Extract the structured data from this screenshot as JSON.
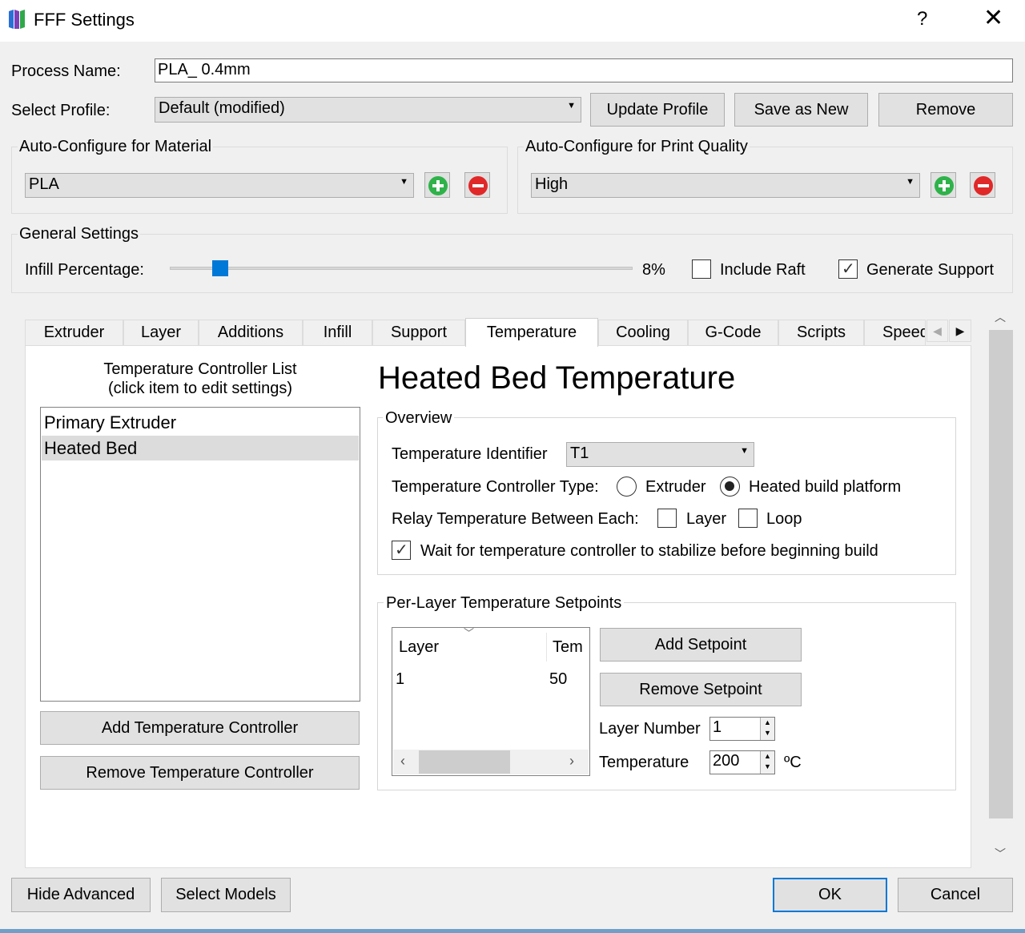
{
  "window": {
    "title": "FFF Settings",
    "help": "?",
    "close": "✕"
  },
  "process": {
    "label": "Process Name:",
    "value": "PLA_ 0.4mm"
  },
  "profile": {
    "label": "Select Profile:",
    "value": "Default (modified)",
    "update": "Update Profile",
    "save_new": "Save as New",
    "remove": "Remove"
  },
  "material": {
    "title": "Auto-Configure for Material",
    "value": "PLA"
  },
  "quality": {
    "title": "Auto-Configure for Print Quality",
    "value": "High"
  },
  "general": {
    "title": "General Settings",
    "infill_label": "Infill Percentage:",
    "infill_value": "8%",
    "infill_fraction": 0.08,
    "raft_label": "Include Raft",
    "raft_checked": false,
    "support_label": "Generate Support",
    "support_checked": true
  },
  "tabs": [
    "Extruder",
    "Layer",
    "Additions",
    "Infill",
    "Support",
    "Temperature",
    "Cooling",
    "G-Code",
    "Scripts",
    "Speed"
  ],
  "active_tab": "Temperature",
  "controllers": {
    "title_line1": "Temperature Controller List",
    "title_line2": "(click item to edit settings)",
    "items": [
      "Primary Extruder",
      "Heated Bed"
    ],
    "selected": "Heated Bed",
    "add": "Add Temperature Controller",
    "remove": "Remove Temperature Controller"
  },
  "detail": {
    "heading": "Heated Bed Temperature",
    "overview": {
      "title": "Overview",
      "identifier_label": "Temperature Identifier",
      "identifier_value": "T1",
      "type_label": "Temperature Controller Type:",
      "type_extruder": "Extruder",
      "type_platform": "Heated build platform",
      "type_selected": "Heated build platform",
      "relay_label": "Relay Temperature Between Each:",
      "relay_layer": "Layer",
      "relay_loop": "Loop",
      "wait_label": "Wait for temperature controller to stabilize before beginning build",
      "wait_checked": true
    },
    "setpoints": {
      "title": "Per-Layer Temperature Setpoints",
      "col_layer": "Layer",
      "col_temp": "Tem",
      "rows": [
        {
          "layer": "1",
          "temp": "50"
        }
      ],
      "add": "Add Setpoint",
      "remove": "Remove Setpoint",
      "layer_number_label": "Layer Number",
      "layer_number_value": "1",
      "temperature_label": "Temperature",
      "temperature_value": "200",
      "unit": "ºC"
    }
  },
  "footer": {
    "hide_advanced": "Hide Advanced",
    "select_models": "Select Models",
    "ok": "OK",
    "cancel": "Cancel"
  },
  "colors": {
    "accent": "#0078d7",
    "add_green": "#2fb24a",
    "remove_red": "#e02828",
    "selection": "#dcdcdc"
  }
}
